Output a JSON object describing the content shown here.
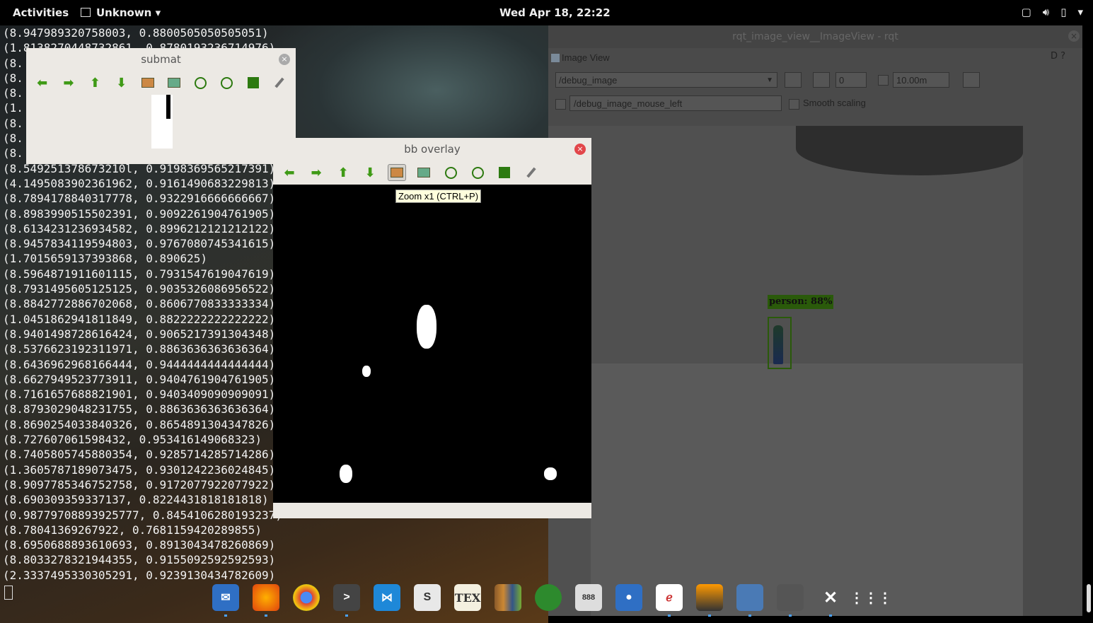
{
  "topbar": {
    "activities": "Activities",
    "app_name": "Unknown ▾",
    "clock": "Wed Apr 18, 22:22",
    "tray_icons": [
      "window-icon",
      "volume-icon",
      "battery-icon",
      "menu-arrow-icon"
    ]
  },
  "terminal": {
    "lines": [
      "(8.947989320758003, 0.8800505050505051)",
      "(1.8138270448732861, 0.8780193236714976)",
      "(8.",
      "(8.",
      "(8.",
      "(1.",
      "(8.",
      "(8.",
      "(8.",
      "(8.549251378673210l, 0.9198369565217391)",
      "(4.1495083902361962, 0.9161490683229813)",
      "(8.7894178840317778, 0.9322916666666667)",
      "(8.8983990515502391, 0.9092261904761905)",
      "(8.6134231236934582, 0.8996212121212122)",
      "(8.9457834119594803, 0.9767080745341615)",
      "(1.7015659137393868, 0.890625)",
      "(8.5964871911601115, 0.7931547619047619)",
      "(8.7931495605125125, 0.9035326086956522)",
      "(8.8842772886702068, 0.8606770833333334)",
      "(1.0451862941811849, 0.8822222222222222)",
      "(8.9401498728616424, 0.9065217391304348)",
      "(8.5376623192311971, 0.8863636363636364)",
      "(8.6436962968166444, 0.9444444444444444)",
      "(8.6627949523773911, 0.9404761904761905)",
      "(8.7161657688821901, 0.9403409090909091)",
      "(8.8793029048231755, 0.8863636363636364)",
      "(8.8690254033840326, 0.8654891304347826)",
      "(8.727607061598432, 0.953416149068323)",
      "(8.7405805745880354, 0.9285714285714286)",
      "(1.3605787189073475, 0.9301242236024845)",
      "(8.9097785346752758, 0.9172077922077922)",
      "(8.690309359337137, 0.8224431818181818)",
      "(0.98779708893925777, 0.8454106280193237)",
      "(8.78041369267922, 0.7681159420289855)",
      "(8.6950688893610693, 0.8913043478260869)",
      "(8.8033278321944355, 0.9155092592592593)",
      "(2.3337495330305291, 0.9239130434782609)"
    ]
  },
  "rqt": {
    "window_title": "rqt_image_view__ImageView - rqt",
    "pane_title": "Image View",
    "help_label": "D",
    "topic_value": "/debug_image",
    "spin_value": "0",
    "max_value": "10.00m",
    "mouse_topic": "/debug_image_mouse_left",
    "smooth_label": "Smooth scaling",
    "detection_label": "person:  88%"
  },
  "submat": {
    "title": "submat"
  },
  "bb_overlay": {
    "title": "bb overlay",
    "tooltip": "Zoom x1 (CTRL+P)"
  },
  "dock": {
    "items": [
      "mail-icon",
      "firefox-icon",
      "chrome-icon",
      "terminal-icon",
      "vscode-icon",
      "slack-icon",
      "tex-icon",
      "books-icon",
      "pidgin-icon",
      "dice-icon",
      "toggle-icon",
      "editor-icon",
      "layers-icon",
      "image-viewer-icon",
      "window-icon",
      "tools-icon",
      "app-grid-icon"
    ],
    "tex_label": "TEX",
    "slack_label": "S",
    "terminal_label": ">"
  },
  "colors": {
    "detection_box": "#2a5a0a",
    "toolbar_green": "#3f9a16",
    "close_red": "#e2464a"
  }
}
